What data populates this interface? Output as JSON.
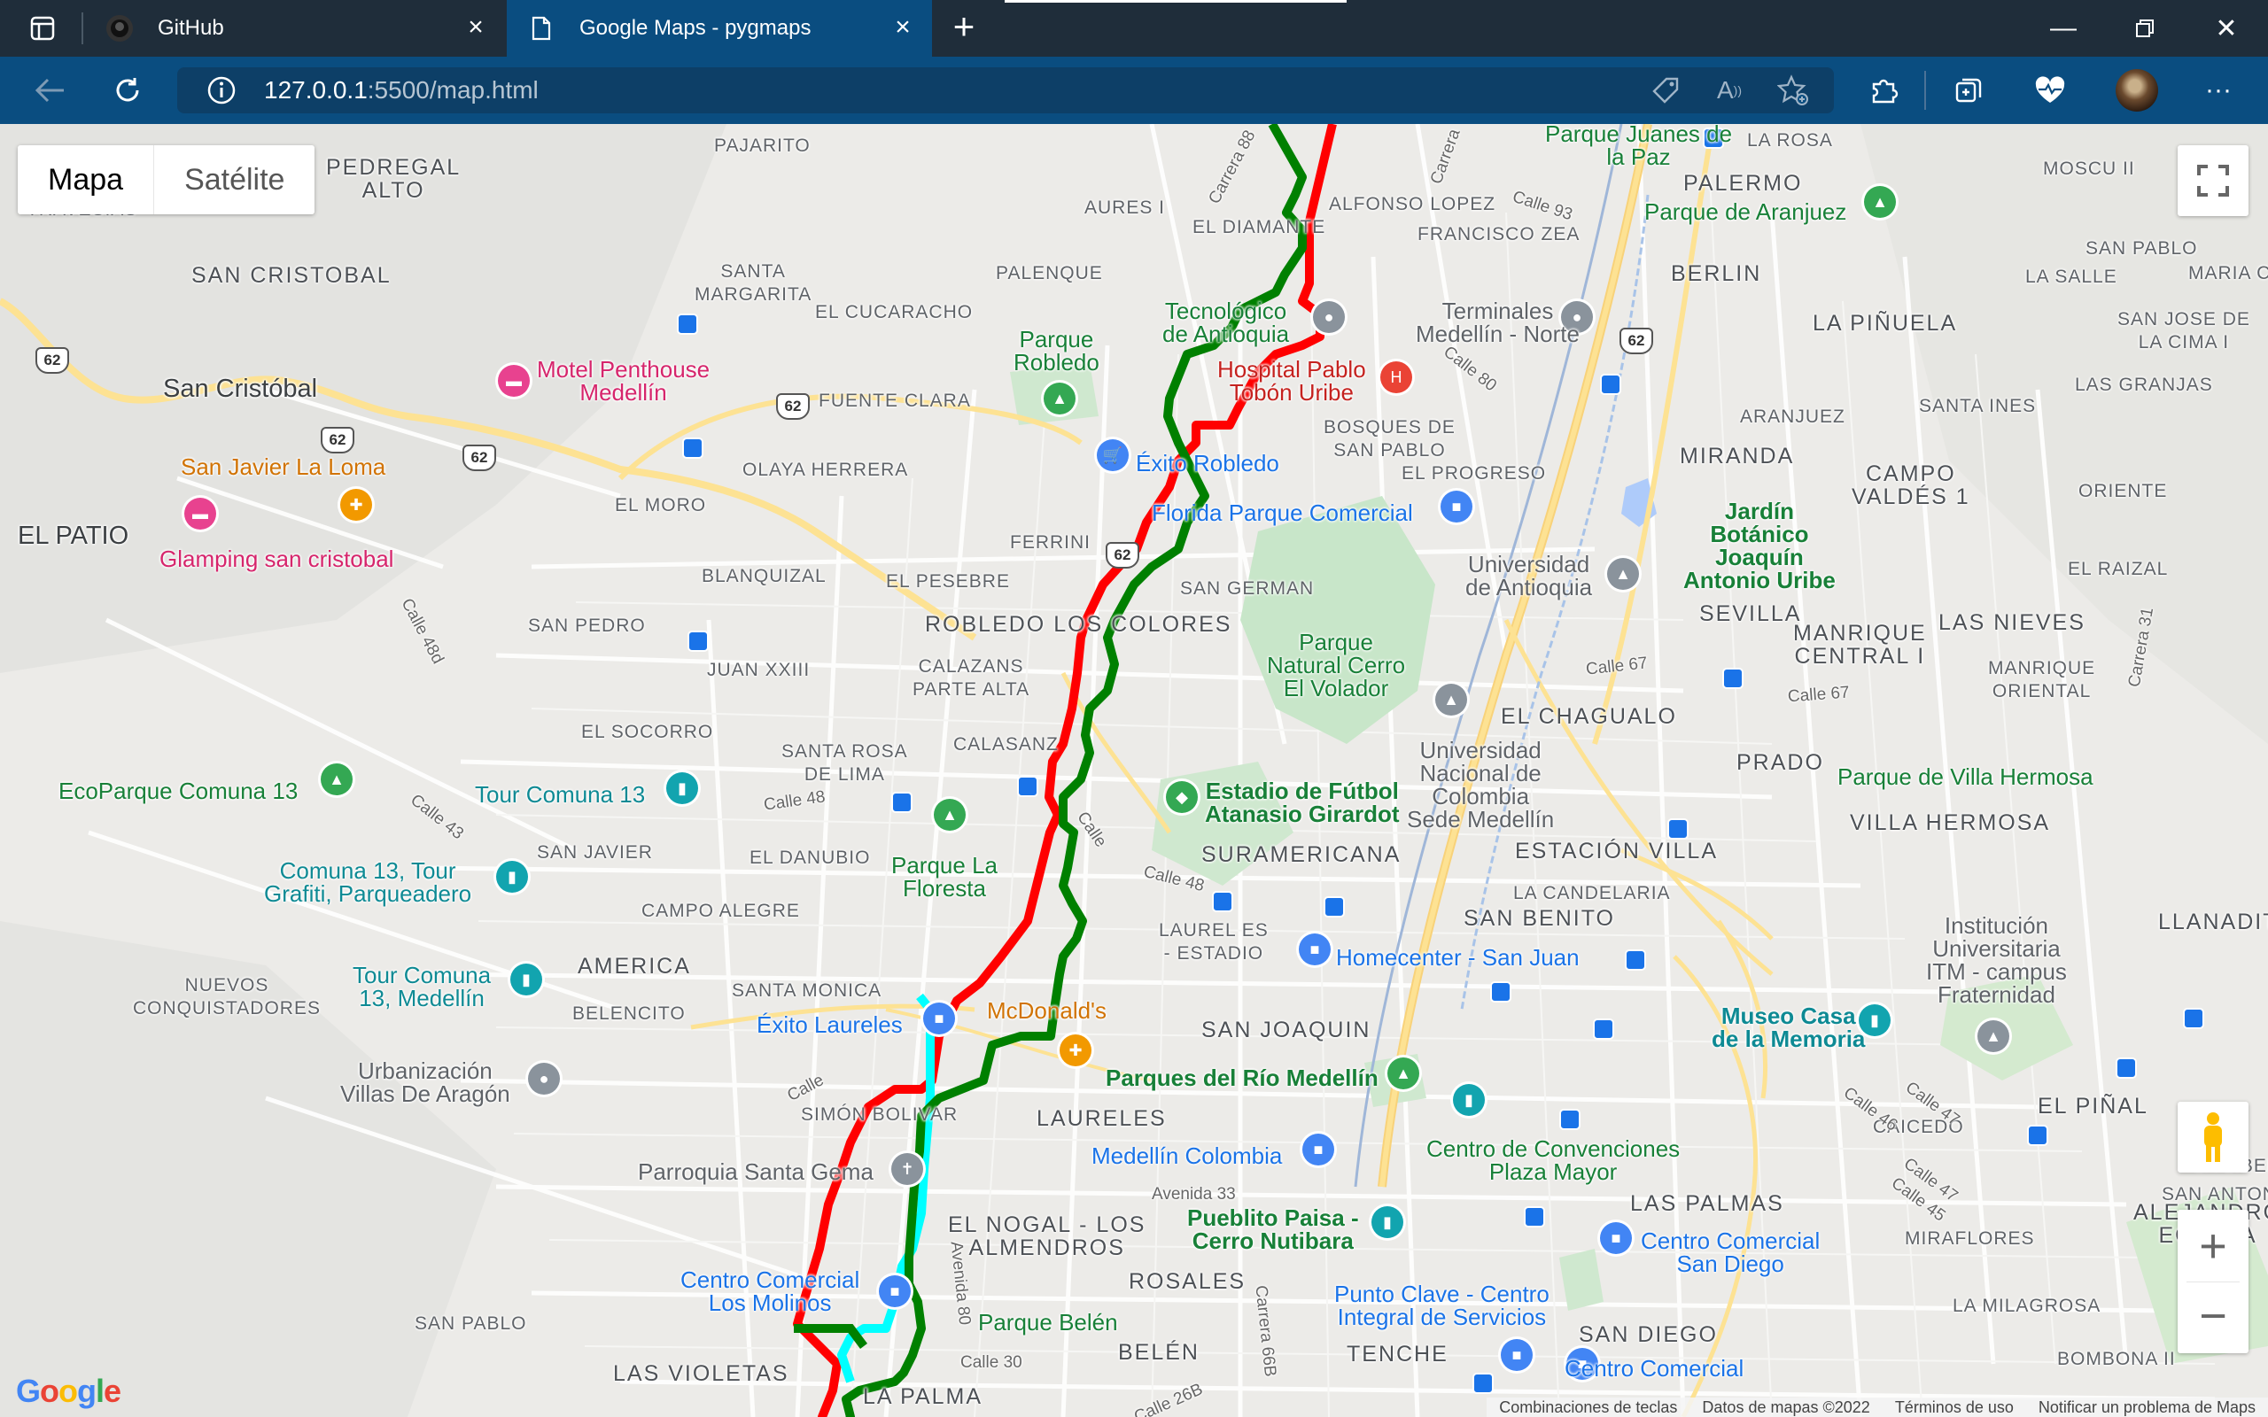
{
  "browser": {
    "tabs": [
      {
        "title": "GitHub",
        "active": false
      },
      {
        "title": "Google Maps - pygmaps",
        "active": true
      }
    ],
    "url_host": "127.0.0.1",
    "url_path": ":5500/map.html"
  },
  "map": {
    "map_type": {
      "map": "Mapa",
      "satellite": "Satélite"
    },
    "footer": {
      "shortcuts": "Combinaciones de teclas",
      "data": "Datos de mapas ©2022",
      "terms": "Términos de uso",
      "report": "Notificar un problema de Maps"
    },
    "google_logo": "Google",
    "routes": [
      {
        "color": "#ff0000"
      },
      {
        "color": "#008000"
      },
      {
        "color": "#00ffff"
      }
    ],
    "labels": {
      "pedregal_alto": "PEDREGAL\nALTO",
      "travesias": "TRAVESIAS",
      "pajarito": "PAJARITO",
      "san_cristobal": "SAN CRISTOBAL",
      "san_cristobal_city": "San Cristóbal",
      "santa_margarita": "SANTA\nMARGARITA",
      "el_cucaracho": "EL CUCARACHO",
      "palenque": "PALENQUE",
      "aures": "AURES I",
      "el_diamante": "EL DIAMANTE",
      "alfonso_lopez": "ALFONSO LOPEZ",
      "francisco_zea": "FRANCISCO ZEA",
      "palermo": "PALERMO",
      "moscu": "MOSCU II",
      "berlin": "BERLIN",
      "san_pablo_ne": "SAN PABLO",
      "la_salle": "LA SALLE",
      "maria_c": "MARIA C",
      "san_jose_cima": "SAN JOSE DE\nLA CIMA I",
      "la_pinuela": "LA PIÑUELA",
      "las_granjas": "LAS GRANJAS",
      "santa_ines": "SANTA INES",
      "aranjuez": "ARANJUEZ",
      "miranda": "MIRANDA",
      "campo_valdes": "CAMPO\nVALDÉS 1",
      "oriente": "ORIENTE",
      "el_raizal": "EL RAIZAL",
      "sevilla": "SEVILLA",
      "manrique": "MANRIQUE\nCENTRAL I",
      "las_nieves": "LAS NIEVES",
      "manrique_oriental": "MANRIQUE\nORIENTAL",
      "fuente_clara": "FUENTE CLARA",
      "olaya_herrera": "OLAYA HERRERA",
      "el_moro": "EL MORO",
      "el_patio": "EL PATIO",
      "bosques": "BOSQUES DE\nSAN PABLO",
      "el_progreso": "EL PROGRESO",
      "ferrini": "FERRINI",
      "san_german": "SAN GERMAN",
      "blanquizal": "BLANQUIZAL",
      "el_pesebre": "EL PESEBRE",
      "san_pedro": "SAN PEDRO",
      "juan_xxiii": "JUAN XXIII",
      "robledo": "ROBLEDO LOS COLORES",
      "calazans": "CALAZANS\nPARTE ALTA",
      "el_socorro": "EL SOCORRO",
      "santa_rosa": "SANTA ROSA\nDE LIMA",
      "calasanz": "CALASANZ",
      "el_chagualo": "EL CHAGUALO",
      "prado": "PRADO",
      "san_javier": "SAN JAVIER",
      "el_danubio": "EL DANUBIO",
      "suramericana": "SURAMERICANA",
      "estacion_villa": "ESTACIÓN VILLA",
      "villa_hermosa": "VILLA HERMOSA",
      "la_candelaria": "LA CANDELARIA",
      "campo_alegre": "CAMPO ALEGRE",
      "laureles_estadio": "LAUREL ES\n- ESTADIO",
      "san_benito": "SAN BENITO",
      "llanaditas": "LLANADIT",
      "nuevos": "NUEVOS\nCONQUISTADORES",
      "america": "AMERICA",
      "santa_monica": "SANTA MONICA",
      "belencito": "BELENCITO",
      "san_joaquin": "SAN JOAQUIN",
      "simon_bolivar": "SIMÓN BOLIVAR",
      "laureles": "LAURELES",
      "caicedo": "CAICEDO",
      "el_pinal": "EL PIÑAL",
      "la_libertad": "LA LIBER",
      "san_antonio": "SAN ANTONIO",
      "alejandro": "ALEJANDRO\nECHAVA",
      "el_nogal": "EL NOGAL - LOS\nALMENDROS",
      "las_palmas": "LAS PALMAS",
      "miraflores": "MIRAFLORES",
      "rosales": "ROSALES",
      "la_milagrosa": "LA MILAGROSA",
      "bombona": "BOMBONA II",
      "san_pablo_sw": "SAN PABLO",
      "las_violetas": "LAS VIOLETAS",
      "belen": "BELÉN",
      "tenche": "TENCHE",
      "san_diego": "SAN DIEGO",
      "la_palma": "LA PALMA",
      "la_rosa": "LA ROSA",
      "calle93": "Calle 93",
      "calle80": "Calle 80",
      "carrera88": "Carrera 88",
      "carrera": "Carrera",
      "calle48d": "Calle 48d",
      "calle43": "Calle 43",
      "calle48": "Calle 48",
      "calle48b": "Calle 48",
      "calle67": "Calle 67",
      "calle67b": "Calle 67",
      "avenida33": "Avenida 33",
      "avenida80": "Avenida 80",
      "calle30": "Calle 30",
      "carrera66b": "Carrera 66B",
      "calle46": "Calle 46",
      "calle47": "Calle 47",
      "calle47b": "Calle 47",
      "calle45": "Calle 45",
      "carrera31": "Carrera 31",
      "calle26b": "Calle 26B",
      "calle_pb": "Calle",
      "calle_cal": "Calle",
      "nutibara_callout": "Calle"
    },
    "pois": {
      "parque_juanes": "Parque Juanes de\nla Paz",
      "parque_aranjuez": "Parque de Aranjuez",
      "tecnologico": "Tecnológico\nde Antioquia",
      "terminales": "Terminales\nMedellín - Norte",
      "parque_robledo": "Parque\nRobledo",
      "hospital": "Hospital Pablo\nTobón Uribe",
      "motel": "Motel Penthouse\nMedellín",
      "san_javier_loma": "San Javier La Loma",
      "glamping": "Glamping san cristobal",
      "exito_robledo": "Éxito Robledo",
      "florida": "Florida Parque Comercial",
      "universidad_antioquia": "Universidad\nde Antioquia",
      "jardin": "Jardín\nBotánico\nJoaquín\nAntonio Uribe",
      "parque_volador": "Parque\nNatural Cerro\nEl Volador",
      "unal": "Universidad\nNacional de\nColombia\nSede Medellín",
      "ecoparque": "EcoParque Comuna 13",
      "tour_comuna13": "Tour Comuna 13",
      "comuna13_grafiti": "Comuna 13, Tour\nGrafiti, Parqueadero",
      "estadio": "Estadio de Fútbol\nAtanasio Girardot",
      "parque_floresta": "Parque La\nFloresta",
      "parque_villa_hermosa": "Parque de Villa Hermosa",
      "homecenter": "Homecenter - San Juan",
      "tour_comuna13_medellin": "Tour Comuna\n13, Medellín",
      "exito_laureles": "Éxito Laureles",
      "mcdonalds": "McDonald's",
      "institucion_itm": "Institución\nUniversitaria\nITM - campus\nFraternidad",
      "museo": "Museo Casa\nde la Memoria",
      "parques_rio": "Parques del Río Medellín",
      "urbanizacion": "Urbanización\nVillas De Aragón",
      "medellin_colombia": "Medellín Colombia",
      "centro_convenciones": "Centro de Convenciones\nPlaza Mayor",
      "parroquia": "Parroquia Santa Gema",
      "pueblito": "Pueblito Paisa -\nCerro Nutibara",
      "cc_san_diego": "Centro Comercial\nSan Diego",
      "cc_molinos": "Centro Comercial\nLos Molinos",
      "parque_belen": "Parque Belén",
      "punto_clave": "Punto Clave - Centro\nIntegral de Servicios",
      "cc_bottom": "Centro Comercial"
    },
    "highway_badges": [
      "62",
      "62",
      "62",
      "62",
      "62",
      "62"
    ],
    "icons": {
      "fullscreen": "fullscreen-icon",
      "pegman": "pegman-icon",
      "zoom_in": "+",
      "zoom_out": "−"
    }
  }
}
